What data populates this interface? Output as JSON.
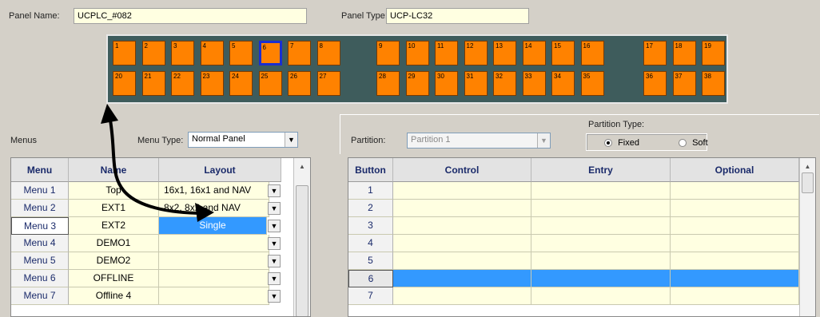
{
  "panel": {
    "name_label": "Panel Name:",
    "name_value": "UCPLC_#082",
    "type_label": "Panel Type:",
    "type_value": "UCP-LC32",
    "keys_row1": [
      "1",
      "2",
      "3",
      "4",
      "5",
      "6",
      "7",
      "8",
      "9",
      "10",
      "11",
      "12",
      "13",
      "14",
      "15",
      "16",
      "17",
      "18",
      "19"
    ],
    "keys_row2": [
      "20",
      "21",
      "22",
      "23",
      "24",
      "25",
      "26",
      "27",
      "28",
      "29",
      "30",
      "31",
      "32",
      "33",
      "34",
      "35",
      "36",
      "37",
      "38"
    ],
    "selected_key": "6"
  },
  "menus": {
    "section_label": "Menus",
    "menu_type_label": "Menu Type:",
    "menu_type_value": "Normal Panel",
    "columns": [
      "Menu",
      "Name",
      "Layout"
    ],
    "rows": [
      {
        "menu": "Menu 1",
        "name": "Top",
        "layout": "16x1, 16x1 and NAV"
      },
      {
        "menu": "Menu 2",
        "name": "EXT1",
        "layout": "8x2, 8x2 and NAV"
      },
      {
        "menu": "Menu 3",
        "name": "EXT2",
        "layout": "Single"
      },
      {
        "menu": "Menu 4",
        "name": "DEMO1",
        "layout": ""
      },
      {
        "menu": "Menu 5",
        "name": "DEMO2",
        "layout": ""
      },
      {
        "menu": "Menu 6",
        "name": "OFFLINE",
        "layout": ""
      },
      {
        "menu": "Menu 7",
        "name": "Offline 4",
        "layout": ""
      }
    ]
  },
  "partition": {
    "label": "Partition:",
    "value": "Partition 1",
    "type_label": "Partition Type:",
    "fixed_label": "Fixed",
    "soft_label": "Soft",
    "selected_type": "Fixed",
    "columns": [
      "Button",
      "Control",
      "Entry",
      "Optional"
    ],
    "rows": [
      "1",
      "2",
      "3",
      "4",
      "5",
      "6",
      "7"
    ],
    "selected_row": "6"
  },
  "icons": {
    "dropdown": "chevron-down-icon",
    "scroll_up": "scroll-up-icon",
    "arrow": "double-headed-arrow"
  }
}
